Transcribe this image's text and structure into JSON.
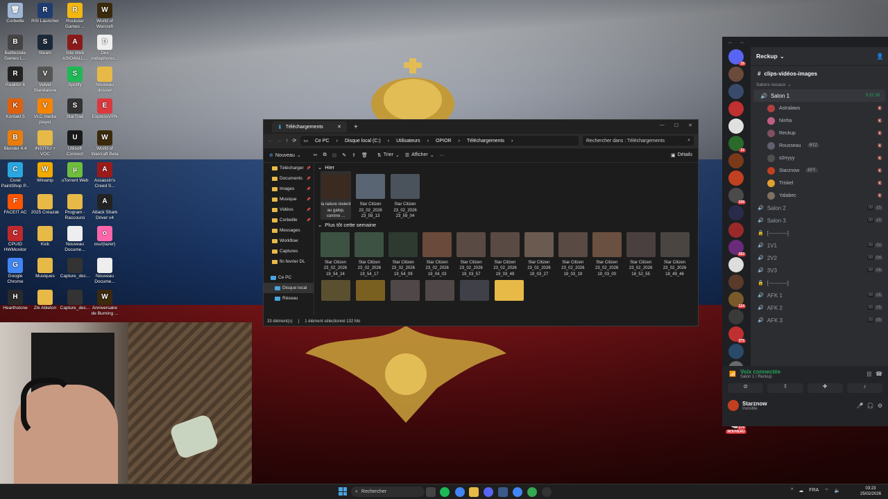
{
  "desktop_icons": [
    {
      "label": "Corbeille",
      "color": "#9fb7d6",
      "glyph": "🗑"
    },
    {
      "label": "RSI Launcher",
      "color": "#1e3c70",
      "glyph": "R"
    },
    {
      "label": "Rockstar Games ...",
      "color": "#f3b712",
      "glyph": "R"
    },
    {
      "label": "World of Warcraft",
      "color": "#3b2a0d",
      "glyph": "W"
    },
    {
      "label": "Battlestate Games L...",
      "color": "#444",
      "glyph": "B"
    },
    {
      "label": "Steam",
      "color": "#1b2838",
      "glyph": "S"
    },
    {
      "label": "Site Web ASIO4ALL...",
      "color": "#8b1a1a",
      "glyph": "A"
    },
    {
      "label": "Dex métaphores...",
      "color": "#eee",
      "glyph": "D"
    },
    {
      "label": "Reaktor 6",
      "color": "#222",
      "glyph": "R"
    },
    {
      "label": "Velvet Standalone",
      "color": "#555",
      "glyph": "V"
    },
    {
      "label": "Spotify",
      "color": "#1db954",
      "glyph": "S"
    },
    {
      "label": "Nouveau dossier",
      "color": "#e7b947",
      "glyph": ""
    },
    {
      "label": "Kontakt 5",
      "color": "#e0600f",
      "glyph": "K"
    },
    {
      "label": "VLC media player",
      "color": "#f58400",
      "glyph": "V"
    },
    {
      "label": "StarTrad",
      "color": "#333",
      "glyph": "S"
    },
    {
      "label": "ExpressVPN",
      "color": "#da3940",
      "glyph": "E"
    },
    {
      "label": "Blender 4.4",
      "color": "#e87d0d",
      "glyph": "B"
    },
    {
      "label": "INSTRU + VOC",
      "color": "#e7b947",
      "glyph": ""
    },
    {
      "label": "Ubisoft Connect",
      "color": "#1a1a1a",
      "glyph": "U"
    },
    {
      "label": "World of Warcraft Beta",
      "color": "#3b2a0d",
      "glyph": "W"
    },
    {
      "label": "Corel PaintShop P...",
      "color": "#2aa7e0",
      "glyph": "C"
    },
    {
      "label": "Winamp",
      "color": "#f2a900",
      "glyph": "W"
    },
    {
      "label": "uTorrent Web",
      "color": "#6ebe3c",
      "glyph": "µ"
    },
    {
      "label": "Assassin's Creed S...",
      "color": "#9b1b1b",
      "glyph": "A"
    },
    {
      "label": "FACEIT AC",
      "color": "#ff5500",
      "glyph": "F"
    },
    {
      "label": "2025 Créazak",
      "color": "#e7b947",
      "glyph": ""
    },
    {
      "label": "Program - Raccourci",
      "color": "#e7b947",
      "glyph": ""
    },
    {
      "label": "Attack Shark Driver v4",
      "color": "#222",
      "glyph": "A"
    },
    {
      "label": "CPUID HWMonitor",
      "color": "#c0282c",
      "glyph": "C"
    },
    {
      "label": "Kick",
      "color": "#e7b947",
      "glyph": ""
    },
    {
      "label": "Nouveau Docume...",
      "color": "#eee",
      "glyph": ""
    },
    {
      "label": "osu!(lazer)",
      "color": "#ff66aa",
      "glyph": "o"
    },
    {
      "label": "Google Chrome",
      "color": "#4285f4",
      "glyph": "G"
    },
    {
      "label": "Musiques",
      "color": "#e7b947",
      "glyph": ""
    },
    {
      "label": "Capture_dec...",
      "color": "#333",
      "glyph": ""
    },
    {
      "label": "Nouveau Docume...",
      "color": "#eee",
      "glyph": ""
    },
    {
      "label": "Hearthstone",
      "color": "#2a2a2a",
      "glyph": "H"
    },
    {
      "label": "Zik Ableton",
      "color": "#e7b947",
      "glyph": ""
    },
    {
      "label": "Capture_dec...",
      "color": "#333",
      "glyph": ""
    },
    {
      "label": "Anniversaire de Burning ...",
      "color": "#3b2a0d",
      "glyph": "W"
    }
  ],
  "explorer": {
    "tab_title": "Téléchargements",
    "new_tab": "+",
    "window_controls": [
      "—",
      "☐",
      "✕"
    ],
    "breadcrumb": [
      "Ce PC",
      "Disque local (C:)",
      "Utilisateurs",
      "OPIOR",
      "Téléchargements"
    ],
    "search_placeholder": "Rechercher dans : Téléchargements",
    "toolbar": {
      "new": "Nouveau",
      "sort": "Trier",
      "view": "Afficher",
      "more": "···",
      "details": "Détails"
    },
    "nav": [
      {
        "label": "Télécharger",
        "pin": true
      },
      {
        "label": "Documents",
        "pin": true
      },
      {
        "label": "Images",
        "pin": true
      },
      {
        "label": "Musique",
        "pin": true
      },
      {
        "label": "Vidéos",
        "pin": true
      },
      {
        "label": "Corbeille",
        "pin": true
      },
      {
        "label": "Messages",
        "pin": false
      },
      {
        "label": "Workflow",
        "pin": false
      },
      {
        "label": "Captures",
        "pin": false
      },
      {
        "label": "fin fevrier DL",
        "pin": false
      },
      {
        "label": "Ce PC",
        "pin": false
      },
      {
        "label": "Disque local",
        "pin": false
      },
      {
        "label": "Réseau",
        "pin": false
      }
    ],
    "group_today": "Hier",
    "group_week": "Plus tôt cette semaine",
    "files_today": [
      {
        "name": "la nature revient au galop, comme ...",
        "color": "#3a2a20"
      },
      {
        "name": "Star Citizen 23_02_2026 23_59_13",
        "color": "#5a6573"
      },
      {
        "name": "Star Citizen 23_02_2026 23_59_04",
        "color": "#4a525c"
      }
    ],
    "files_week": [
      {
        "name": "Star Citizen 23_02_2026 19_54_24",
        "color": "#3d5242"
      },
      {
        "name": "Star Citizen 23_02_2026 19_54_17",
        "color": "#3d5242"
      },
      {
        "name": "Star Citizen 23_02_2026 19_54_09",
        "color": "#2e3a30"
      },
      {
        "name": "Star Citizen 23_02_2026 19_04_03",
        "color": "#6a4a3a"
      },
      {
        "name": "Star Citizen 23_02_2026 19_03_57",
        "color": "#5a4a44"
      },
      {
        "name": "Star Citizen 23_02_2026 19_03_49",
        "color": "#5a4a44"
      },
      {
        "name": "Star Citizen 23_02_2026 19_03_27",
        "color": "#6a5a50"
      },
      {
        "name": "Star Citizen 23_02_2026 19_03_19",
        "color": "#5a4a44"
      },
      {
        "name": "Star Citizen 23_02_2026 19_03_00",
        "color": "#6a5040"
      },
      {
        "name": "Star Citizen 23_02_2026 18_52_55",
        "color": "#4a4040"
      },
      {
        "name": "Star Citizen 23_02_2026 18_49_46",
        "color": "#4a4540"
      }
    ],
    "files_row3": [
      {
        "color": "#5a5030"
      },
      {
        "color": "#7a6020"
      },
      {
        "color": "#504848"
      },
      {
        "color": "#504848"
      },
      {
        "color": "#404048"
      },
      {
        "color": "#e7b947"
      }
    ],
    "status": {
      "count": "33 élément(s)",
      "selection": "1 élément sélectionné  132 Mo"
    }
  },
  "discord": {
    "server_name": "Reckup",
    "text_channel": "clips-vidéos-images",
    "voice_category": "Salons vocaux",
    "active_channel": "Salon 1",
    "active_time": "5:21:39",
    "members": [
      {
        "name": "Astralaws",
        "color": "#b04040",
        "tag": ""
      },
      {
        "name": "Ninha",
        "color": "#c06080",
        "tag": ""
      },
      {
        "name": "Reckup",
        "color": "#805060",
        "tag": ""
      },
      {
        "name": "Rousseau",
        "color": "#606070",
        "tag": "RTZ"
      },
      {
        "name": "s0rryyy",
        "color": "#505050",
        "tag": ""
      },
      {
        "name": "Starznow",
        "color": "#c04020",
        "tag": "EFT"
      },
      {
        "name": "Triskel",
        "color": "#e0a030",
        "tag": ""
      },
      {
        "name": "Yalabec",
        "color": "#807060",
        "tag": ""
      }
    ],
    "voice_channels": [
      {
        "name": "Salon 2",
        "count": "00",
        "limit": "15"
      },
      {
        "name": "Salon 3",
        "count": "00",
        "limit": "15"
      },
      {
        "name": "[----------]",
        "count": "",
        "limit": ""
      },
      {
        "name": "1V1",
        "count": "00",
        "limit": "02"
      },
      {
        "name": "2V2",
        "count": "00",
        "limit": "04"
      },
      {
        "name": "3V3",
        "count": "00",
        "limit": "06"
      },
      {
        "name": "[----------]",
        "count": "",
        "limit": ""
      },
      {
        "name": "AFK 1",
        "count": "00",
        "limit": "05"
      },
      {
        "name": "AFK 2",
        "count": "00",
        "limit": "05"
      },
      {
        "name": "AFK 3",
        "count": "00",
        "limit": "05"
      }
    ],
    "server_badges": [
      "15",
      "",
      "",
      "",
      "",
      "22",
      "",
      "",
      "199",
      "",
      "",
      "283",
      "",
      "",
      "124",
      "",
      "375",
      "",
      "",
      "22",
      "",
      "375"
    ],
    "new_label": "NOUVEAU",
    "voice_status": "Voix connectée",
    "voice_location": "Salon 1 / Reckup",
    "user_name": "Starznow",
    "user_status": "Invisible"
  },
  "taskbar": {
    "search": "Rechercher",
    "lang": "FRA",
    "time": "03:23",
    "date": "25/02/2026"
  }
}
